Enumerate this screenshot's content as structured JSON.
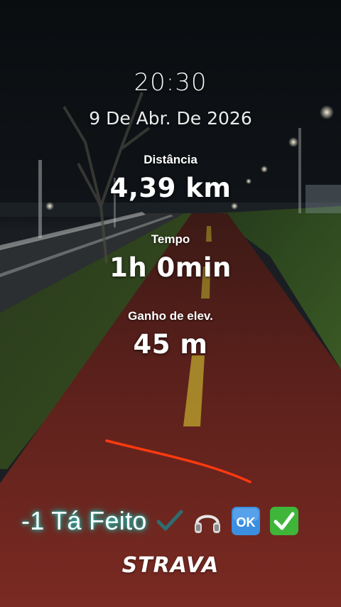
{
  "header": {
    "time": "20:30",
    "date": "9 De Abr. De 2026"
  },
  "stats": [
    {
      "label": "Distância",
      "value": "4,39 km"
    },
    {
      "label": "Tempo",
      "value": "1h 0min"
    },
    {
      "label": "Ganho de elev.",
      "value": "45 m"
    }
  ],
  "caption": {
    "text": "-1 Tá Feito",
    "emojis": [
      "check-mark-icon",
      "headphones-icon",
      "ok-button-icon",
      "check-box-icon"
    ]
  },
  "brand": {
    "logo": "STRAVA"
  },
  "colors": {
    "route_line": "#ff3a0f",
    "caption_glow": "#2fd5c6",
    "path_red": "#6e1f1a"
  }
}
